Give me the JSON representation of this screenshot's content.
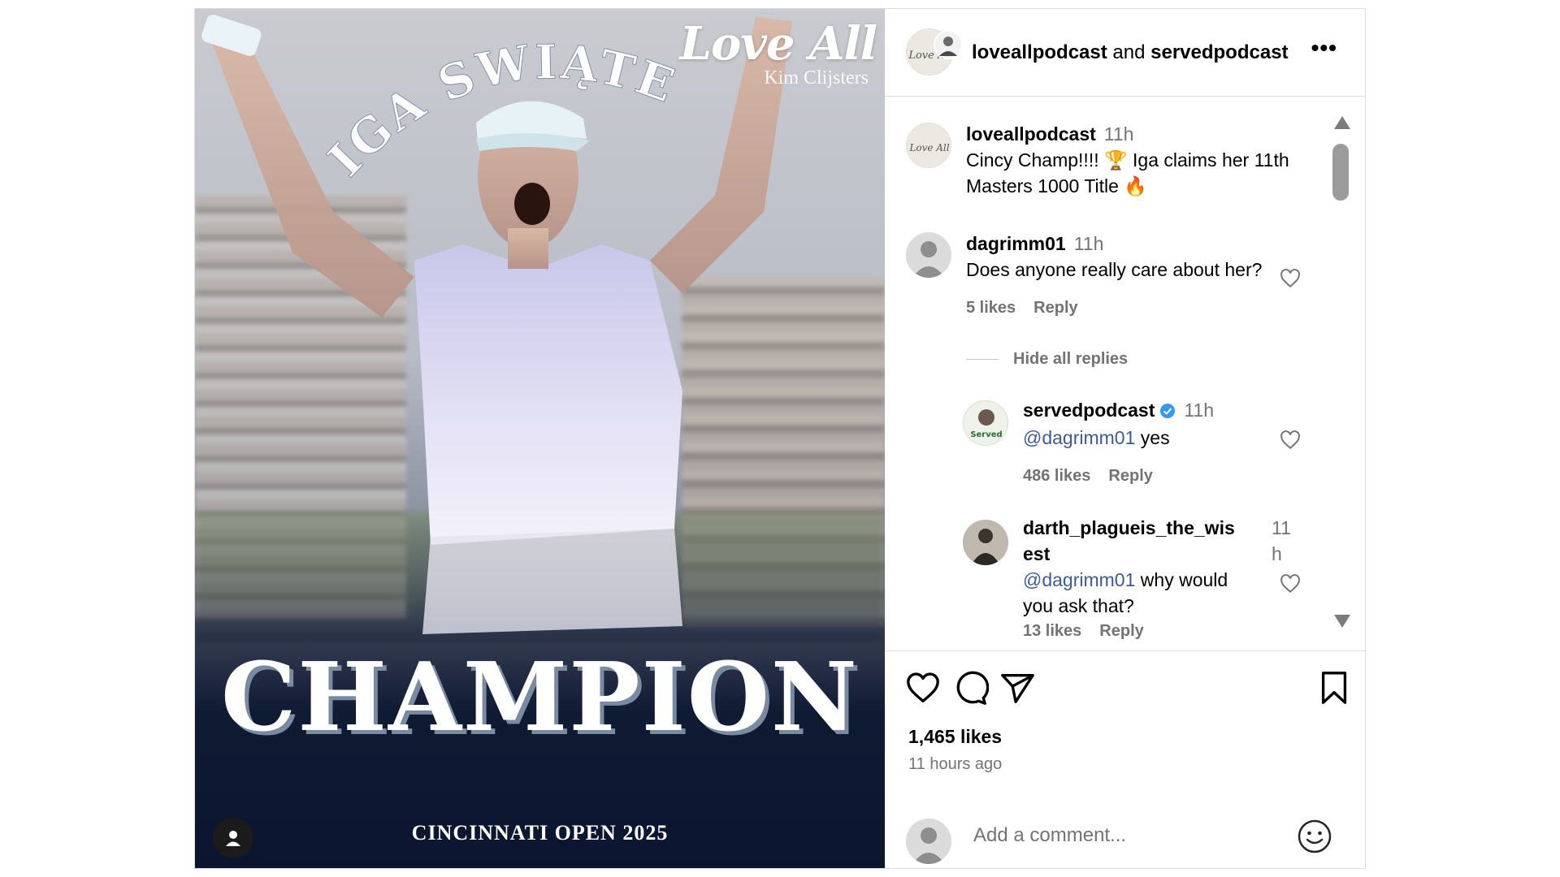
{
  "media": {
    "brand_name": "Love All",
    "brand_sub": "Kim Clijsters",
    "arc_title": "IGA SWIĄTEK",
    "headline": "CHAMPION",
    "event": "CINCINNATI OPEN 2025"
  },
  "header": {
    "user1": "loveallpodcast",
    "joiner": " and ",
    "user2": "servedpodcast",
    "more": "•••"
  },
  "caption": {
    "user": "loveallpodcast",
    "time": "11h",
    "text_line1": "Cincy Champ!!!! 🏆 Iga claims her 11th",
    "text_line2": "Masters 1000 Title 🔥"
  },
  "comments": [
    {
      "user": "dagrimm01",
      "time": "11h",
      "text": "Does anyone really care about her?",
      "likes": "5 likes",
      "reply": "Reply",
      "toggle": "Hide all replies"
    }
  ],
  "replies": [
    {
      "user": "servedpodcast",
      "time": "11h",
      "mention": "@dagrimm01",
      "text": " yes",
      "likes": "486 likes",
      "reply": "Reply"
    },
    {
      "user_line1": "darth_plagueis_the_wis",
      "user_line2": "est",
      "time_line1": "11",
      "time_line2": "h",
      "mention": "@dagrimm01",
      "text_line1": " why would",
      "text_line2": "you ask that?",
      "likes": "13 likes",
      "reply": "Reply"
    }
  ],
  "footer": {
    "likes": "1,465 likes",
    "ago": "11 hours ago",
    "placeholder": "Add a comment..."
  },
  "icons": {
    "like": "heart-icon",
    "comment": "comment-icon",
    "share": "send-icon",
    "save": "bookmark-icon",
    "emoji": "smiley-icon",
    "verified": "verified-badge-icon"
  },
  "colors": {
    "mention": "#3d5a9b",
    "verified": "#3897f0",
    "secondary_text": "#737373",
    "divider": "#dbdbdb"
  }
}
